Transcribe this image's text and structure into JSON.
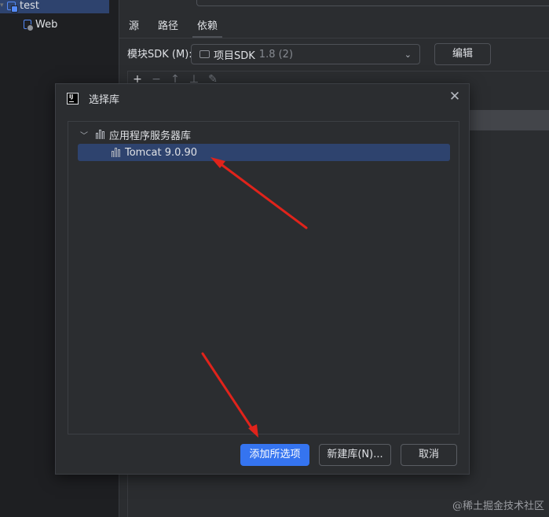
{
  "project_tree": {
    "items": [
      {
        "label": "test",
        "icon": "module-icon",
        "selected": true
      },
      {
        "label": "Web",
        "icon": "web-facet-icon",
        "selected": false
      }
    ]
  },
  "settings": {
    "tabs": [
      {
        "label": "源",
        "active": false
      },
      {
        "label": "路径",
        "active": false
      },
      {
        "label": "依赖",
        "active": true
      }
    ],
    "sdk_label": "模块SDK (M):",
    "sdk_value": "项目SDK",
    "sdk_version": "1.8 (2)",
    "edit_button": "编辑",
    "toolbar_icons": [
      "add-icon",
      "remove-icon",
      "move-up-icon",
      "move-down-icon",
      "edit-icon"
    ]
  },
  "dialog": {
    "title": "选择库",
    "close_icon": "close-icon",
    "tree": {
      "group_label": "应用程序服务器库",
      "expanded": true,
      "items": [
        {
          "label": "Tomcat 9.0.90",
          "selected": true
        }
      ]
    },
    "buttons": {
      "add_selected": "添加所选项",
      "new_library": "新建库(N)...",
      "cancel": "取消"
    }
  },
  "colors": {
    "accent": "#3574f0",
    "selection": "#2e436e",
    "annotation_arrow": "#e0231b"
  },
  "watermark": "@稀土掘金技术社区"
}
